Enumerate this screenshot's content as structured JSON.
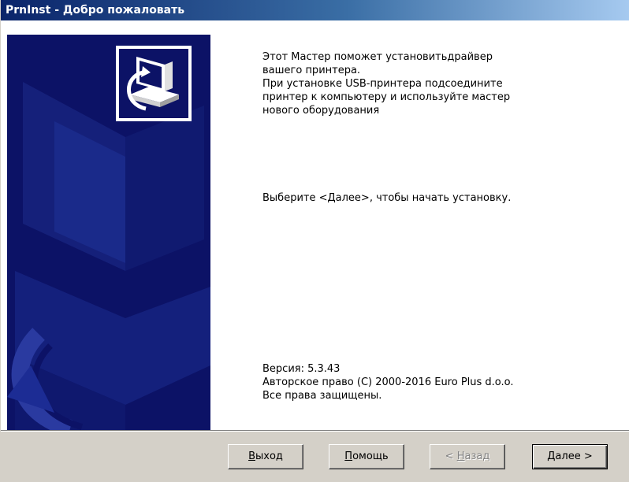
{
  "window": {
    "title": "PrnInst - Добро пожаловать"
  },
  "intro": {
    "lines": [
      "Этот Мастер поможет установитьдрайвер",
      "вашего принтера.",
      "При установке USB-принтера подсоедините",
      "принтер к компьютеру и используйте мастер",
      "нового оборудования"
    ],
    "start_hint": "Выберите <Далее>, чтобы начать установку."
  },
  "info": {
    "version": "Версия: 5.3.43",
    "copyright": "Авторское право (C) 2000-2016 Euro Plus d.o.o.",
    "rights": "Все права защищены."
  },
  "buttons": {
    "exit": {
      "accel": "В",
      "rest": "ыход"
    },
    "help": {
      "accel": "П",
      "rest": "омощь"
    },
    "back": {
      "prefix": "< ",
      "accel": "Н",
      "rest": "азад"
    },
    "next": {
      "accel": "Д",
      "rest": "алее >"
    }
  },
  "colors": {
    "panel_blue": "#0c1266",
    "title_start": "#0a246a",
    "title_end": "#a6caf0",
    "button_face": "#d4d0c8"
  },
  "icons": {
    "logo": "computer-install-icon"
  }
}
